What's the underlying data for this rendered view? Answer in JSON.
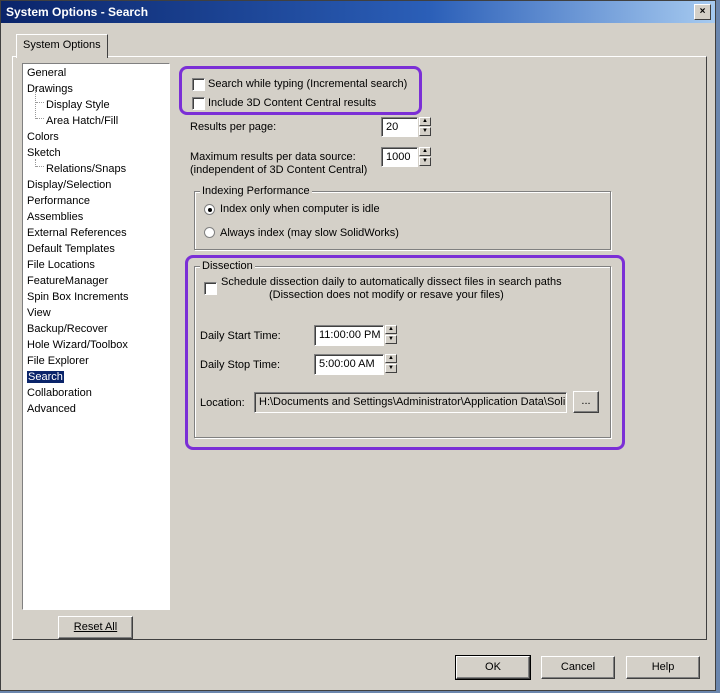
{
  "window": {
    "title": "System Options - Search",
    "close_label": "×"
  },
  "tab": {
    "label": "System Options"
  },
  "tree": {
    "items": [
      {
        "label": "General"
      },
      {
        "label": "Drawings"
      },
      {
        "label": "Display Style"
      },
      {
        "label": "Area Hatch/Fill"
      },
      {
        "label": "Colors"
      },
      {
        "label": "Sketch"
      },
      {
        "label": "Relations/Snaps"
      },
      {
        "label": "Display/Selection"
      },
      {
        "label": "Performance"
      },
      {
        "label": "Assemblies"
      },
      {
        "label": "External References"
      },
      {
        "label": "Default Templates"
      },
      {
        "label": "File Locations"
      },
      {
        "label": "FeatureManager"
      },
      {
        "label": "Spin Box Increments"
      },
      {
        "label": "View"
      },
      {
        "label": "Backup/Recover"
      },
      {
        "label": "Hole Wizard/Toolbox"
      },
      {
        "label": "File Explorer"
      },
      {
        "label": "Search"
      },
      {
        "label": "Collaboration"
      },
      {
        "label": "Advanced"
      }
    ],
    "selected": "Search"
  },
  "reset_button": "Reset All",
  "search": {
    "incremental_label": "Search while typing (Incremental search)",
    "include_3d_label": "Include 3D Content Central results",
    "results_per_page_label": "Results per page:",
    "results_per_page_value": "20",
    "max_results_label_1": "Maximum results per data source:",
    "max_results_label_2": "(independent of 3D Content Central)",
    "max_results_value": "1000"
  },
  "indexing": {
    "title": "Indexing Performance",
    "option_idle": "Index only when computer is idle",
    "option_always": "Always index (may slow SolidWorks)",
    "selected": "idle"
  },
  "dissection": {
    "title": "Dissection",
    "schedule_label": "Schedule dissection daily to automatically dissect files in search paths",
    "schedule_note": "(Dissection does not modify or resave your files)",
    "start_label": "Daily Start Time:",
    "start_value": "11:00:00 PM",
    "stop_label": "Daily Stop Time:",
    "stop_value": "5:00:00 AM",
    "location_label": "Location:",
    "location_value": "H:\\Documents and Settings\\Administrator\\Application Data\\Soli",
    "browse_label": "..."
  },
  "footer": {
    "ok": "OK",
    "cancel": "Cancel",
    "help": "Help"
  },
  "colors": {
    "highlight": "#7b2fd6",
    "titlebar": "#0a246a",
    "selection": "#0a246a"
  }
}
